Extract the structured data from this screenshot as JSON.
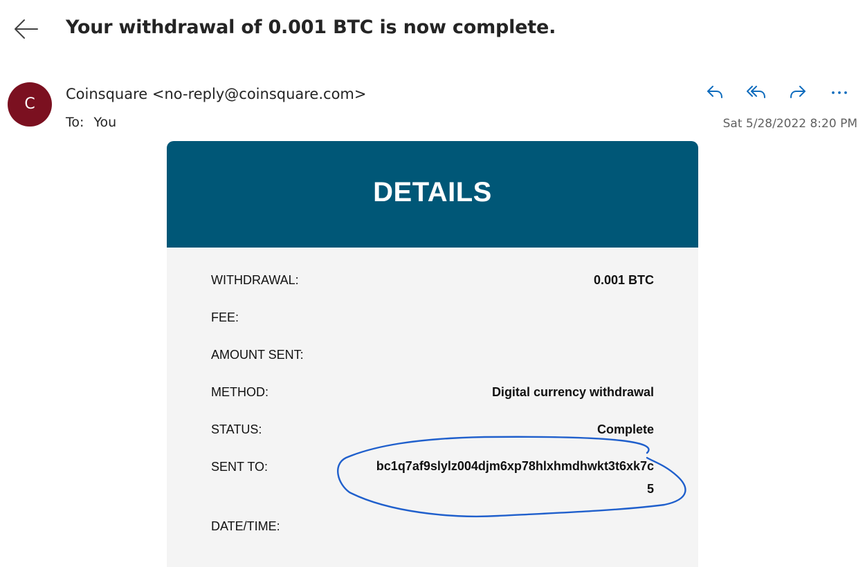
{
  "email": {
    "subject": "Your withdrawal of 0.001 BTC is now complete.",
    "sender": "Coinsquare <no-reply@coinsquare.com>",
    "avatar_initial": "C",
    "avatar_color": "#7b1020",
    "to_label": "To:",
    "to_value": "You",
    "date": "Sat 5/28/2022 8:20 PM",
    "actions": [
      {
        "name": "reply",
        "icon": "reply-icon"
      },
      {
        "name": "reply-all",
        "icon": "reply-all-icon"
      },
      {
        "name": "forward",
        "icon": "forward-icon"
      },
      {
        "name": "more",
        "icon": "more-icon"
      }
    ],
    "accent_color": "#0f6cbd"
  },
  "card": {
    "title": "DETAILS",
    "header_color": "#005777",
    "rows": [
      {
        "label": "WITHDRAWAL:",
        "value": "0.001 BTC"
      },
      {
        "label": "FEE:",
        "value": ""
      },
      {
        "label": "AMOUNT SENT:",
        "value": ""
      },
      {
        "label": "METHOD:",
        "value": "Digital currency withdrawal"
      },
      {
        "label": "STATUS:",
        "value": "Complete"
      },
      {
        "label": "SENT TO:",
        "value": "bc1q7af9slylz004djm6xp78hlxhmdhwkt3t6xk7c5"
      },
      {
        "label": "DATE/TIME:",
        "value": ""
      }
    ]
  },
  "annotation": {
    "type": "hand-drawn ellipse",
    "color": "#1f5fcc",
    "target": "SENT TO address"
  }
}
